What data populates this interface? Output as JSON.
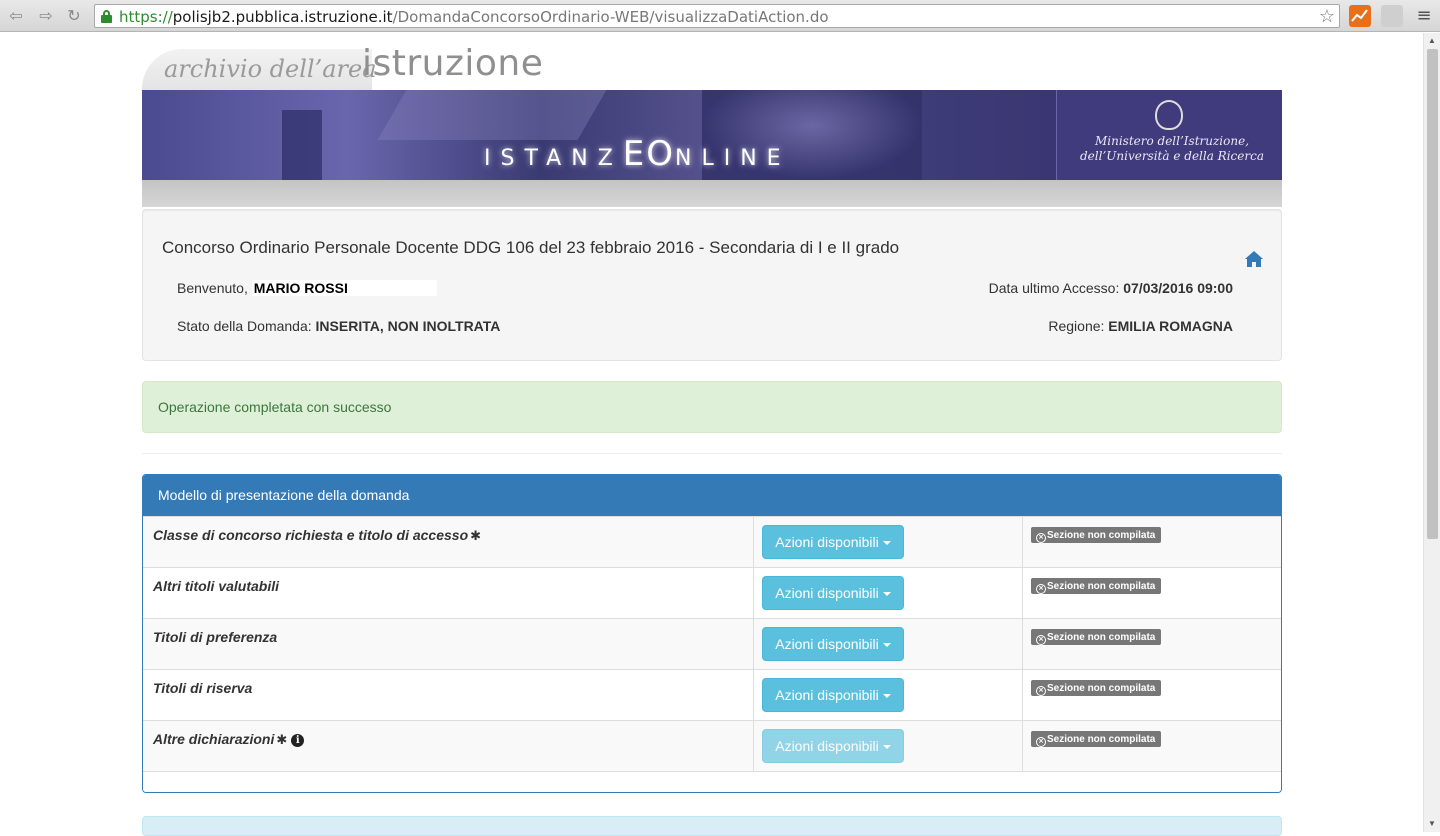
{
  "browser": {
    "url_scheme": "https://",
    "url_host": "polisjb2.pubblica.istruzione.it",
    "url_path": "/DomandaConcorsoOrdinario-WEB/visualizzaDatiAction.do"
  },
  "header": {
    "archivio": "archivio dell’area",
    "istruzione": "istruzione",
    "istanze_part1": "ISTANZ",
    "istanze_big": "EO",
    "istanze_part2": "NLINE",
    "ministero_line1": "Ministero dell’Istruzione,",
    "ministero_line2": "dell’Università e della Ricerca"
  },
  "info": {
    "title": "Concorso Ordinario Personale Docente DDG 106 del 23 febbraio 2016 - Secondaria di I e II grado",
    "welcome_label": "Benvenuto,",
    "user_name": "MARIO ROSSI",
    "last_access_label": "Data ultimo Accesso:",
    "last_access_value": "07/03/2016 09:00",
    "status_label": "Stato della Domanda:",
    "status_value": "INSERITA, NON INOLTRATA",
    "region_label": "Regione:",
    "region_value": "EMILIA ROMAGNA"
  },
  "alert": {
    "message": "Operazione completata con successo"
  },
  "panel": {
    "heading": "Modello di presentazione della domanda",
    "button_label": "Azioni disponibili",
    "status_label": "Sezione non compilata",
    "rows": [
      {
        "title": "Classe di concorso richiesta e titolo di accesso",
        "required": true,
        "info": false,
        "disabled": false
      },
      {
        "title": "Altri titoli valutabili",
        "required": false,
        "info": false,
        "disabled": false
      },
      {
        "title": "Titoli di preferenza",
        "required": false,
        "info": false,
        "disabled": false
      },
      {
        "title": "Titoli di riserva",
        "required": false,
        "info": false,
        "disabled": false
      },
      {
        "title": "Altre dichiarazioni",
        "required": true,
        "info": true,
        "disabled": true
      }
    ]
  },
  "colors": {
    "primary": "#337ab7",
    "info_button": "#5bc0de",
    "success_bg": "#dff0d8",
    "success_text": "#3c763d",
    "label_default": "#777777"
  }
}
